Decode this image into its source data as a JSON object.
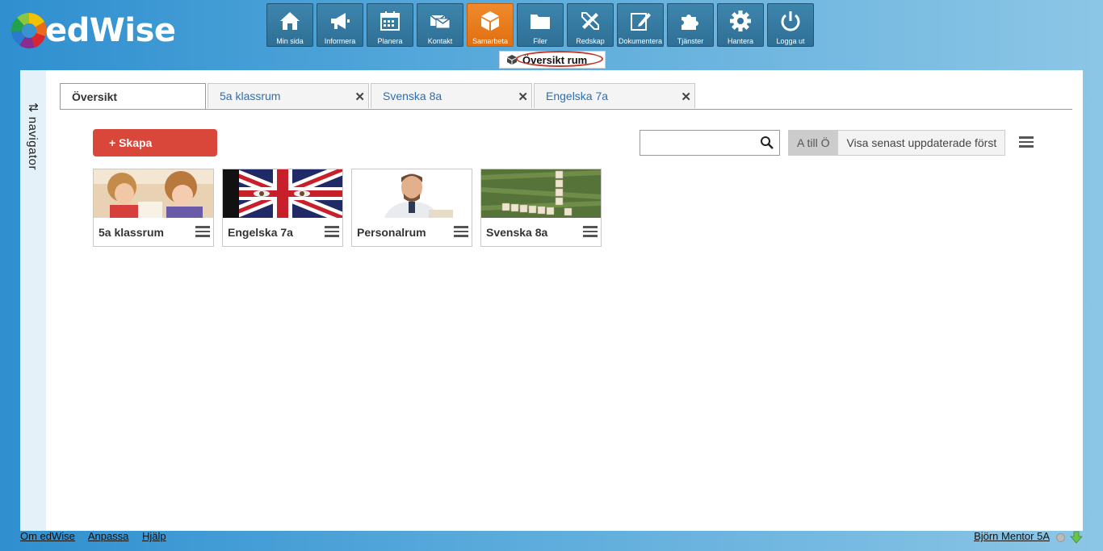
{
  "app": {
    "logo_text": "edWise"
  },
  "toolbar": [
    {
      "id": "min-sida",
      "label": "Min sida",
      "icon": "home-icon"
    },
    {
      "id": "informera",
      "label": "Informera",
      "icon": "megaphone-icon"
    },
    {
      "id": "planera",
      "label": "Planera",
      "icon": "calendar-icon"
    },
    {
      "id": "kontakt",
      "label": "Kontakt",
      "icon": "mail-icon"
    },
    {
      "id": "samarbeta",
      "label": "Samarbeta",
      "icon": "cube-icon",
      "active": true
    },
    {
      "id": "filer",
      "label": "Filer",
      "icon": "folder-icon"
    },
    {
      "id": "redskap",
      "label": "Redskap",
      "icon": "tools-icon"
    },
    {
      "id": "dokumentera",
      "label": "Dokumentera",
      "icon": "edit-icon"
    },
    {
      "id": "tjanster",
      "label": "Tjänster",
      "icon": "puzzle-icon"
    },
    {
      "id": "hantera",
      "label": "Hantera",
      "icon": "gear-icon"
    },
    {
      "id": "logga-ut",
      "label": "Logga ut",
      "icon": "power-icon"
    }
  ],
  "subtab": {
    "label": "Översikt rum"
  },
  "navigator": {
    "label": "navigator",
    "toggle": "⇅"
  },
  "tabs": [
    {
      "label": "Översikt",
      "active": true
    },
    {
      "label": "5a klassrum",
      "closable": true
    },
    {
      "label": "Svenska 8a",
      "closable": true
    },
    {
      "label": "Engelska 7a",
      "closable": true
    }
  ],
  "actions": {
    "create_label": "+ Skapa"
  },
  "search": {
    "placeholder": "",
    "value": ""
  },
  "sort": {
    "az_label": "A till Ö",
    "recent_label": "Visa senast uppdaterade först"
  },
  "rooms": [
    {
      "title": "5a klassrum",
      "image": "children-photo"
    },
    {
      "title": "Engelska 7a",
      "image": "union-jack-face-photo"
    },
    {
      "title": "Personalrum",
      "image": "man-photo"
    },
    {
      "title": "Svenska 8a",
      "image": "letter-tiles-photo"
    }
  ],
  "footer": {
    "links": [
      "Om edWise",
      "Anpassa",
      "Hjälp"
    ],
    "user": "Björn Mentor 5A"
  },
  "colors": {
    "accent_orange": "#e8791b",
    "create_red": "#d9473a",
    "toolbar_blue": "#346f96"
  }
}
